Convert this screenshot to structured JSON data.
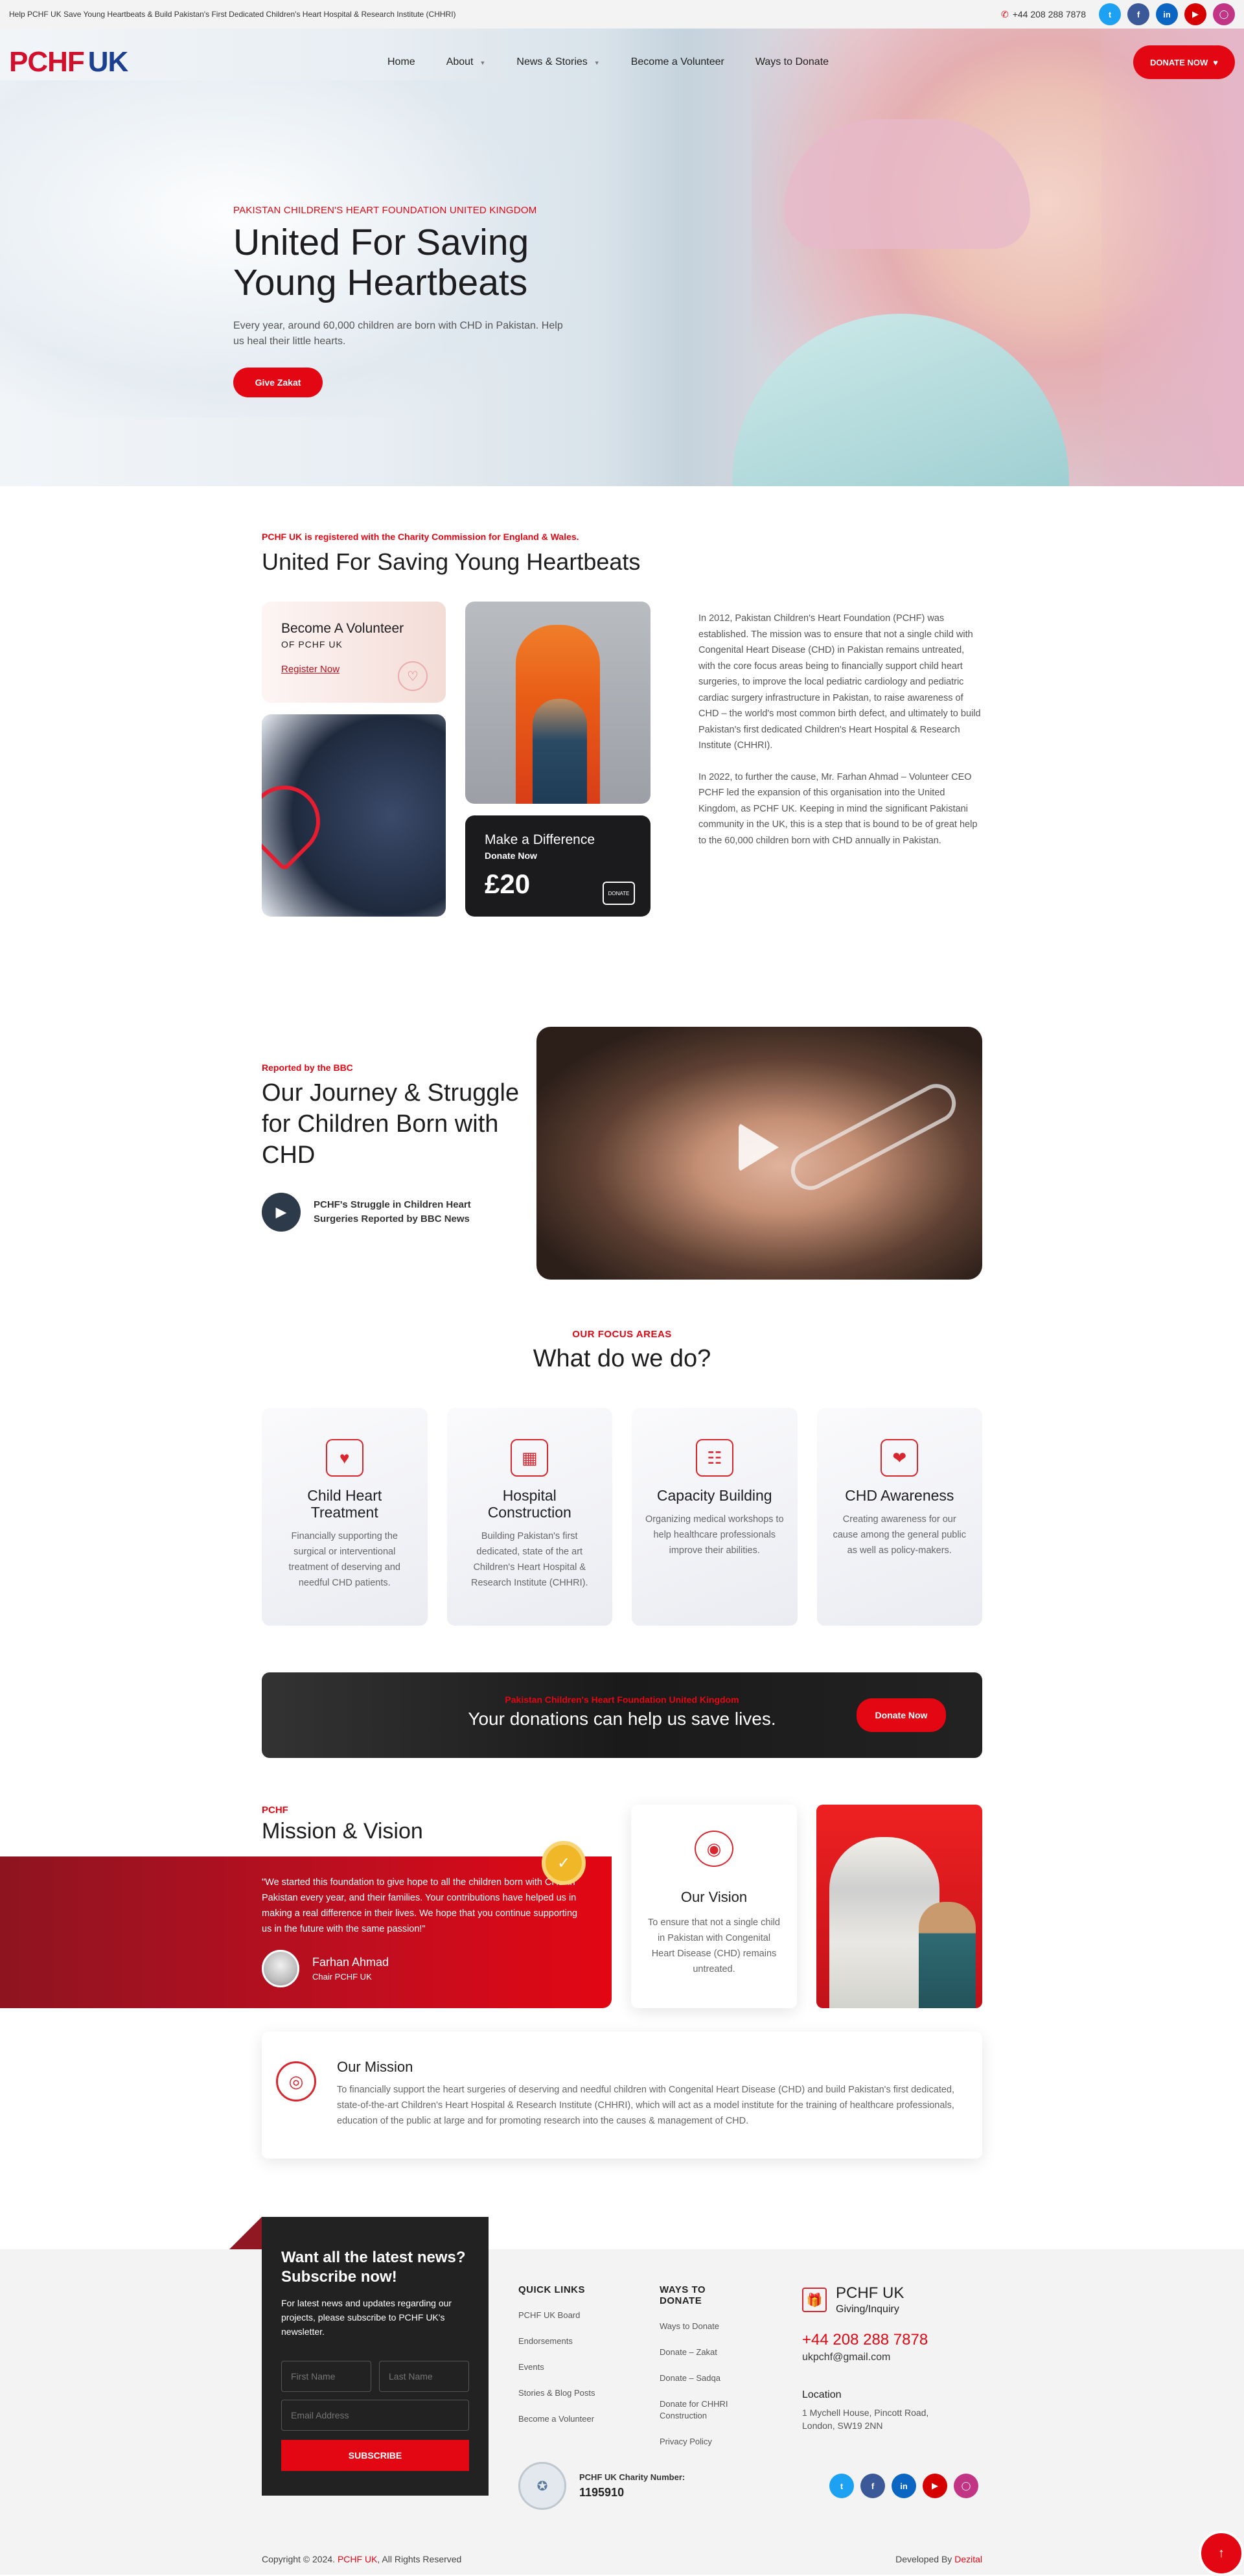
{
  "topbar": {
    "announcement": "Help PCHF UK Save Young Heartbeats & Build Pakistan's First Dedicated Children's Heart Hospital & Research Institute (CHHRI)",
    "phone": "+44 208 288 7878",
    "social": [
      "twitter-icon",
      "facebook-icon",
      "linkedin-icon",
      "youtube-icon",
      "instagram-icon"
    ]
  },
  "nav": {
    "logo_main": "PCHF",
    "logo_uk": "UK",
    "items": [
      "Home",
      "About",
      "News & Stories",
      "Become a Volunteer",
      "Ways to Donate"
    ],
    "donate_label": "DONATE NOW"
  },
  "hero": {
    "eyebrow": "PAKISTAN CHILDREN'S HEART FOUNDATION UNITED KINGDOM",
    "title_line1": "United For Saving",
    "title_line2": "Young Heartbeats",
    "text": "Every year, around 60,000 children are born with CHD in Pakistan. Help us heal their little hearts.",
    "cta": "Give Zakat",
    "slides_total": 4,
    "slide_active": 1
  },
  "about": {
    "registered": "PCHF UK is registered with the Charity Commission for England & Wales.",
    "title": "United For Saving Young Heartbeats",
    "volunteer_title": "Become A Volunteer",
    "volunteer_sub": "OF PCHF UK",
    "volunteer_link": "Register Now",
    "donate_title": "Make a Difference",
    "donate_sub": "Donate Now",
    "donate_amount": "£20",
    "donate_icon_text": "DONATE",
    "para1": "In 2012, Pakistan Children's Heart Foundation (PCHF) was established. The mission was to ensure that not a single child with Congenital Heart Disease (CHD) in Pakistan remains untreated, with the core focus areas being to financially support child heart surgeries, to improve the local pediatric cardiology and pediatric cardiac surgery infrastructure in Pakistan, to raise awareness of CHD – the world's most common birth defect, and ultimately to build Pakistan's first dedicated Children's Heart Hospital & Research Institute (CHHRI).",
    "para2": "In 2022, to further the cause, Mr. Farhan Ahmad – Volunteer CEO PCHF led the expansion of this organisation into the United Kingdom, as PCHF UK. Keeping in mind the significant Pakistani community in the UK, this is a step that is bound to be of great help to the 60,000 children born with CHD annually in Pakistan."
  },
  "journey": {
    "label": "Reported by the BBC",
    "title": "Our Journey & Struggle for Children Born with CHD",
    "video_caption": "PCHF's Struggle in Children Heart Surgeries Reported by BBC News"
  },
  "focus": {
    "label": "OUR FOCUS AREAS",
    "title": "What do we do?",
    "cards": [
      {
        "title": "Child Heart Treatment",
        "text": "Financially supporting the surgical or interventional treatment of deserving and needful CHD patients."
      },
      {
        "title": "Hospital Construction",
        "text": "Building Pakistan's first dedicated, state of the art Children's Heart Hospital & Research Institute (CHHRI)."
      },
      {
        "title": "Capacity Building",
        "text": "Organizing medical workshops to help healthcare professionals improve their abilities."
      },
      {
        "title": "CHD Awareness",
        "text": "Creating awareness for our cause among the general public as well as policy-makers."
      }
    ]
  },
  "banner": {
    "label": "Pakistan Children's Heart Foundation United Kingdom",
    "text": "Your donations can help us save lives.",
    "cta": "Donate Now"
  },
  "mv": {
    "label": "PCHF",
    "title": "Mission & Vision",
    "quote": "\"We started this foundation to give hope to all the children born with CHD in Pakistan every year, and their families. Your contributions have helped us in making a real difference in their lives. We hope that you continue supporting us in the future with the same passion!\"",
    "person_name": "Farhan Ahmad",
    "person_role": "Chair PCHF UK",
    "vision_title": "Our Vision",
    "vision_text": "To ensure that not a single child in Pakistan with Congenital Heart Disease (CHD) remains untreated.",
    "mission_title": "Our Mission",
    "mission_text": "To financially support the heart surgeries of deserving and needful children with Congenital Heart Disease (CHD) and build Pakistan's first dedicated, state-of-the-art Children's Heart Hospital & Research Institute (CHHRI), which will act as a model institute for the training of healthcare professionals, education of the public at large and for promoting research into the causes & management of CHD."
  },
  "footer": {
    "subscribe_title": "Want all the latest news? Subscribe now!",
    "subscribe_text": "For latest news and updates regarding our projects, please subscribe to PCHF UK's newsletter.",
    "first_name_ph": "First Name",
    "last_name_ph": "Last Name",
    "email_ph": "Email Address",
    "subscribe_btn": "SUBSCRIBE",
    "quick_links_title": "QUICK LINKS",
    "quick_links": [
      "PCHF UK Board",
      "Endorsements",
      "Events",
      "Stories & Blog Posts",
      "Become a Volunteer"
    ],
    "ways_title": "WAYS TO DONATE",
    "ways": [
      "Ways to Donate",
      "Donate – Zakat",
      "Donate – Sadqa",
      "Donate for CHHRI Construction",
      "Privacy Policy"
    ],
    "brand_title": "PCHF UK",
    "brand_sub": "Giving/Inquiry",
    "phone": "+44 208 288 7878",
    "email": "ukpchf@gmail.com",
    "location_title": "Location",
    "address": "1 Mychell House, Pincott Road, London, SW19 2NN",
    "charity_label": "PCHF UK Charity Number:",
    "charity_number": "1195910",
    "copyright_prefix": "Copyright © 2024.",
    "copyright_brand": "PCHF UK",
    "copyright_suffix": ", All Rights Reserved",
    "developed_prefix": "Developed By",
    "developed_brand": "Dezital"
  },
  "colors": {
    "accent": "#e30613",
    "dark": "#1d1d1f",
    "footer_bg": "#f3f3f3"
  }
}
